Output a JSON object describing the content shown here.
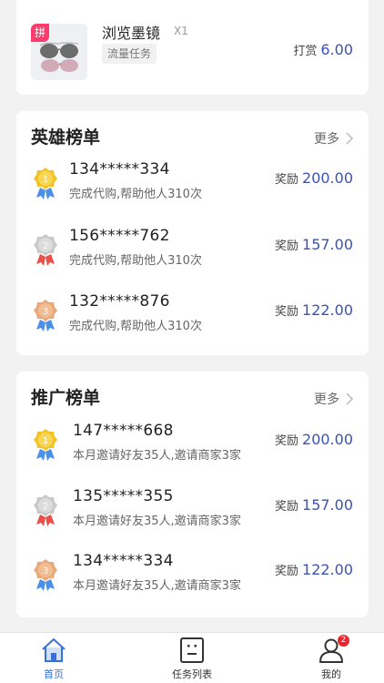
{
  "task": {
    "pin_label": "拼",
    "title": "浏览墨镜",
    "quantity": "X1",
    "tag": "流量任务",
    "reward_label": "打赏",
    "reward_value": "6.00"
  },
  "hero_board": {
    "title": "英雄榜单",
    "more_label": "更多",
    "rows": [
      {
        "rank": "1",
        "phone": "134*****334",
        "desc": "完成代购,帮助他人310次",
        "reward_label": "奖励",
        "reward_value": "200.00"
      },
      {
        "rank": "2",
        "phone": "156*****762",
        "desc": "完成代购,帮助他人310次",
        "reward_label": "奖励",
        "reward_value": "157.00"
      },
      {
        "rank": "3",
        "phone": "132*****876",
        "desc": "完成代购,帮助他人310次",
        "reward_label": "奖励",
        "reward_value": "122.00"
      }
    ]
  },
  "promo_board": {
    "title": "推广榜单",
    "more_label": "更多",
    "rows": [
      {
        "rank": "1",
        "phone": "147*****668",
        "desc": "本月邀请好友35人,邀请商家3家",
        "reward_label": "奖励",
        "reward_value": "200.00"
      },
      {
        "rank": "2",
        "phone": "135*****355",
        "desc": "本月邀请好友35人,邀请商家3家",
        "reward_label": "奖励",
        "reward_value": "157.00"
      },
      {
        "rank": "3",
        "phone": "134*****334",
        "desc": "本月邀请好友35人,邀请商家3家",
        "reward_label": "奖励",
        "reward_value": "122.00"
      }
    ]
  },
  "tabbar": {
    "home": "首页",
    "tasks": "任务列表",
    "mine": "我的",
    "mine_badge": "2"
  },
  "colors": {
    "accent": "#3a53b4",
    "gold": "#f3c326",
    "silver": "#c9c9c9",
    "bronze": "#e9a97a"
  }
}
